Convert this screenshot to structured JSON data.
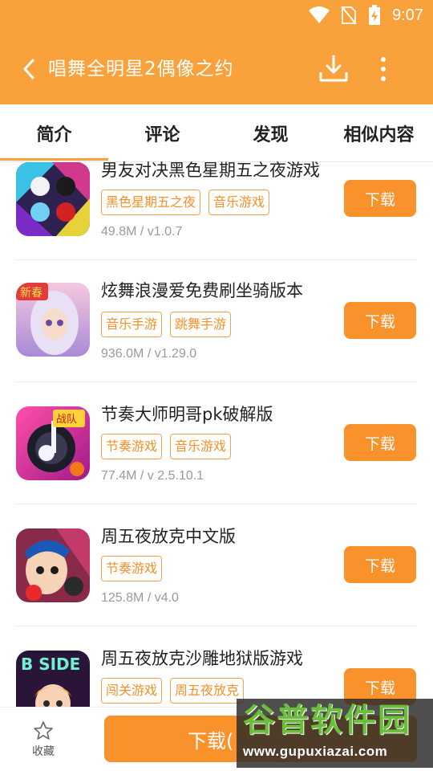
{
  "status": {
    "time": "9:07"
  },
  "header": {
    "title": "唱舞全明星2偶像之约"
  },
  "tabs": [
    {
      "label": "简介"
    },
    {
      "label": "评论"
    },
    {
      "label": "发现"
    },
    {
      "label": "相似内容"
    }
  ],
  "apps": [
    {
      "name": "男友对决黑色星期五之夜游戏",
      "tags": [
        "黑色星期五之夜",
        "音乐游戏"
      ],
      "meta": "49.8M / v1.0.7",
      "button": "下载",
      "icon": "fnf-characters-icon"
    },
    {
      "name": "炫舞浪漫爱免费刷坐骑版本",
      "tags": [
        "音乐手游",
        "跳舞手游"
      ],
      "meta": "936.0M / v1.29.0",
      "button": "下载",
      "icon": "anime-girl-icon"
    },
    {
      "name": "节奏大师明哥pk破解版",
      "tags": [
        "节奏游戏",
        "音乐游戏"
      ],
      "meta": "77.4M / v 2.5.10.1",
      "button": "下载",
      "icon": "music-note-icon"
    },
    {
      "name": "周五夜放克中文版",
      "tags": [
        "节奏游戏"
      ],
      "meta": "125.8M / v4.0",
      "button": "下载",
      "icon": "fnf-boyfriend-icon"
    },
    {
      "name": "周五夜放克沙雕地狱版游戏",
      "tags": [
        "闯关游戏",
        "周五夜放克"
      ],
      "meta": "",
      "button": "下载",
      "icon": "bside-icon"
    }
  ],
  "bottom": {
    "favorite_label": "收藏",
    "download_label": "下载("
  },
  "watermark": {
    "title": "谷普软件园",
    "url": "www.gupuxiazai.com"
  },
  "colors": {
    "accent": "#f9a13a",
    "button": "#f9922b"
  }
}
